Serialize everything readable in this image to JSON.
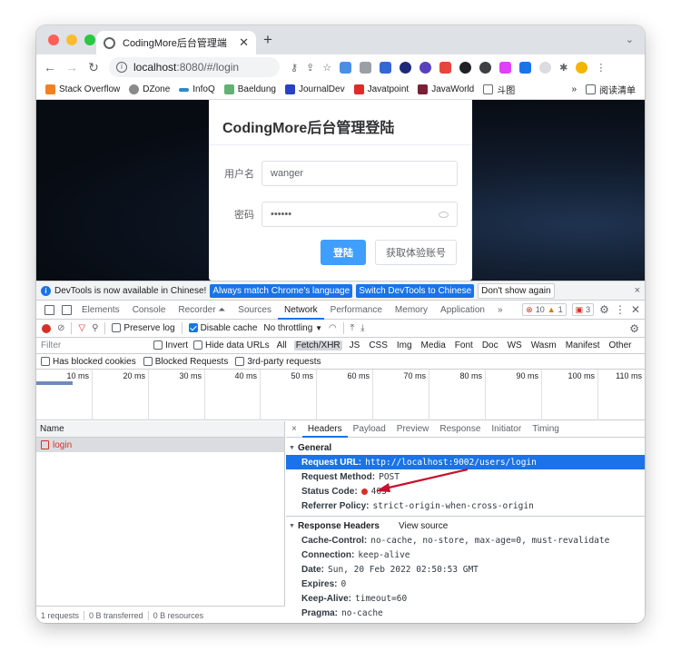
{
  "browser": {
    "tab_title": "CodingMore后台管理端",
    "new_tab": "+",
    "tab_menu": "⌄",
    "url_host": "localhost",
    "url_path": ":8080/#/login",
    "bookmarks": [
      {
        "label": "Stack Overflow",
        "color": "#f48024"
      },
      {
        "label": "DZone",
        "color": "#8a8a8a"
      },
      {
        "label": "InfoQ",
        "color": "#2c89c8"
      },
      {
        "label": "Baeldung",
        "color": "#63b175"
      },
      {
        "label": "JournalDev",
        "color": "#2742c4"
      },
      {
        "label": "Javatpoint",
        "color": "#e02a2a"
      },
      {
        "label": "JavaWorld",
        "color": "#7a1f35"
      },
      {
        "label": "斗图",
        "color": "#6b6b6b"
      }
    ],
    "bookmarks_more": "»",
    "reading_list": "阅读清单"
  },
  "login": {
    "title": "CodingMore后台管理登陆",
    "username_label": "用户名",
    "username_value": "wanger",
    "password_label": "密码",
    "password_value": "••••••",
    "login_button": "登陆",
    "trial_button": "获取体验账号"
  },
  "devtools": {
    "infobar": {
      "message": "DevTools is now available in Chinese!",
      "match_language": "Always match Chrome's language",
      "switch_language": "Switch DevTools to Chinese",
      "dismiss": "Don't show again",
      "close": "×"
    },
    "tabs": [
      "Elements",
      "Console",
      "Recorder ⏶",
      "Sources",
      "Network",
      "Performance",
      "Memory",
      "Application"
    ],
    "more_tabs": "»",
    "error_count": "10",
    "warning_count": "1",
    "issue_count": "3",
    "network_toolbar": {
      "preserve_log": "Preserve log",
      "disable_cache": "Disable cache",
      "throttling": "No throttling"
    },
    "filter": {
      "placeholder": "Filter",
      "invert": "Invert",
      "hide_data_urls": "Hide data URLs",
      "types": [
        "All",
        "Fetch/XHR",
        "JS",
        "CSS",
        "Img",
        "Media",
        "Font",
        "Doc",
        "WS",
        "Wasm",
        "Manifest",
        "Other"
      ],
      "selected_type": "Fetch/XHR"
    },
    "blocked": {
      "has_blocked_cookies": "Has blocked cookies",
      "blocked_requests": "Blocked Requests",
      "third_party": "3rd-party requests"
    },
    "timeline_ticks": [
      "10 ms",
      "20 ms",
      "30 ms",
      "40 ms",
      "50 ms",
      "60 ms",
      "70 ms",
      "80 ms",
      "90 ms",
      "100 ms",
      "110 ms"
    ],
    "requests_header": "Name",
    "requests": [
      {
        "name": "login"
      }
    ],
    "summary": {
      "requests": "1 requests",
      "transferred": "0 B transferred",
      "resources": "0 B resources"
    },
    "detail_tabs": [
      "Headers",
      "Payload",
      "Preview",
      "Response",
      "Initiator",
      "Timing"
    ],
    "detail_close": "×",
    "general": {
      "heading": "General",
      "rows": [
        {
          "key": "Request URL:",
          "value": "http://localhost:9002/users/login"
        },
        {
          "key": "Request Method:",
          "value": "POST"
        },
        {
          "key": "Status Code:",
          "value": "403"
        },
        {
          "key": "Referrer Policy:",
          "value": "strict-origin-when-cross-origin"
        }
      ]
    },
    "response_headers": {
      "heading": "Response Headers",
      "view_source": "View source",
      "rows": [
        {
          "key": "Cache-Control:",
          "value": "no-cache, no-store, max-age=0, must-revalidate"
        },
        {
          "key": "Connection:",
          "value": "keep-alive"
        },
        {
          "key": "Date:",
          "value": "Sun, 20 Feb 2022 02:50:53 GMT"
        },
        {
          "key": "Expires:",
          "value": "0"
        },
        {
          "key": "Keep-Alive:",
          "value": "timeout=60"
        },
        {
          "key": "Pragma:",
          "value": "no-cache"
        }
      ]
    }
  },
  "colors": {
    "accent": "#1a73e8",
    "error": "#d93025",
    "element_primary": "#409eff",
    "close_light": "#ff5f57",
    "minimize_light": "#febc2e",
    "zoom_light": "#28c840"
  },
  "icons": [
    "back-icon",
    "forward-icon",
    "reload-icon",
    "info-icon",
    "key-icon",
    "share-icon",
    "star-icon",
    "extension-icon",
    "profile-icon",
    "more-icon",
    "record-icon",
    "clear-icon",
    "filter-icon",
    "search-icon",
    "wifi-icon",
    "upload-icon",
    "download-icon",
    "gear-icon",
    "arrow-annotation-icon"
  ]
}
